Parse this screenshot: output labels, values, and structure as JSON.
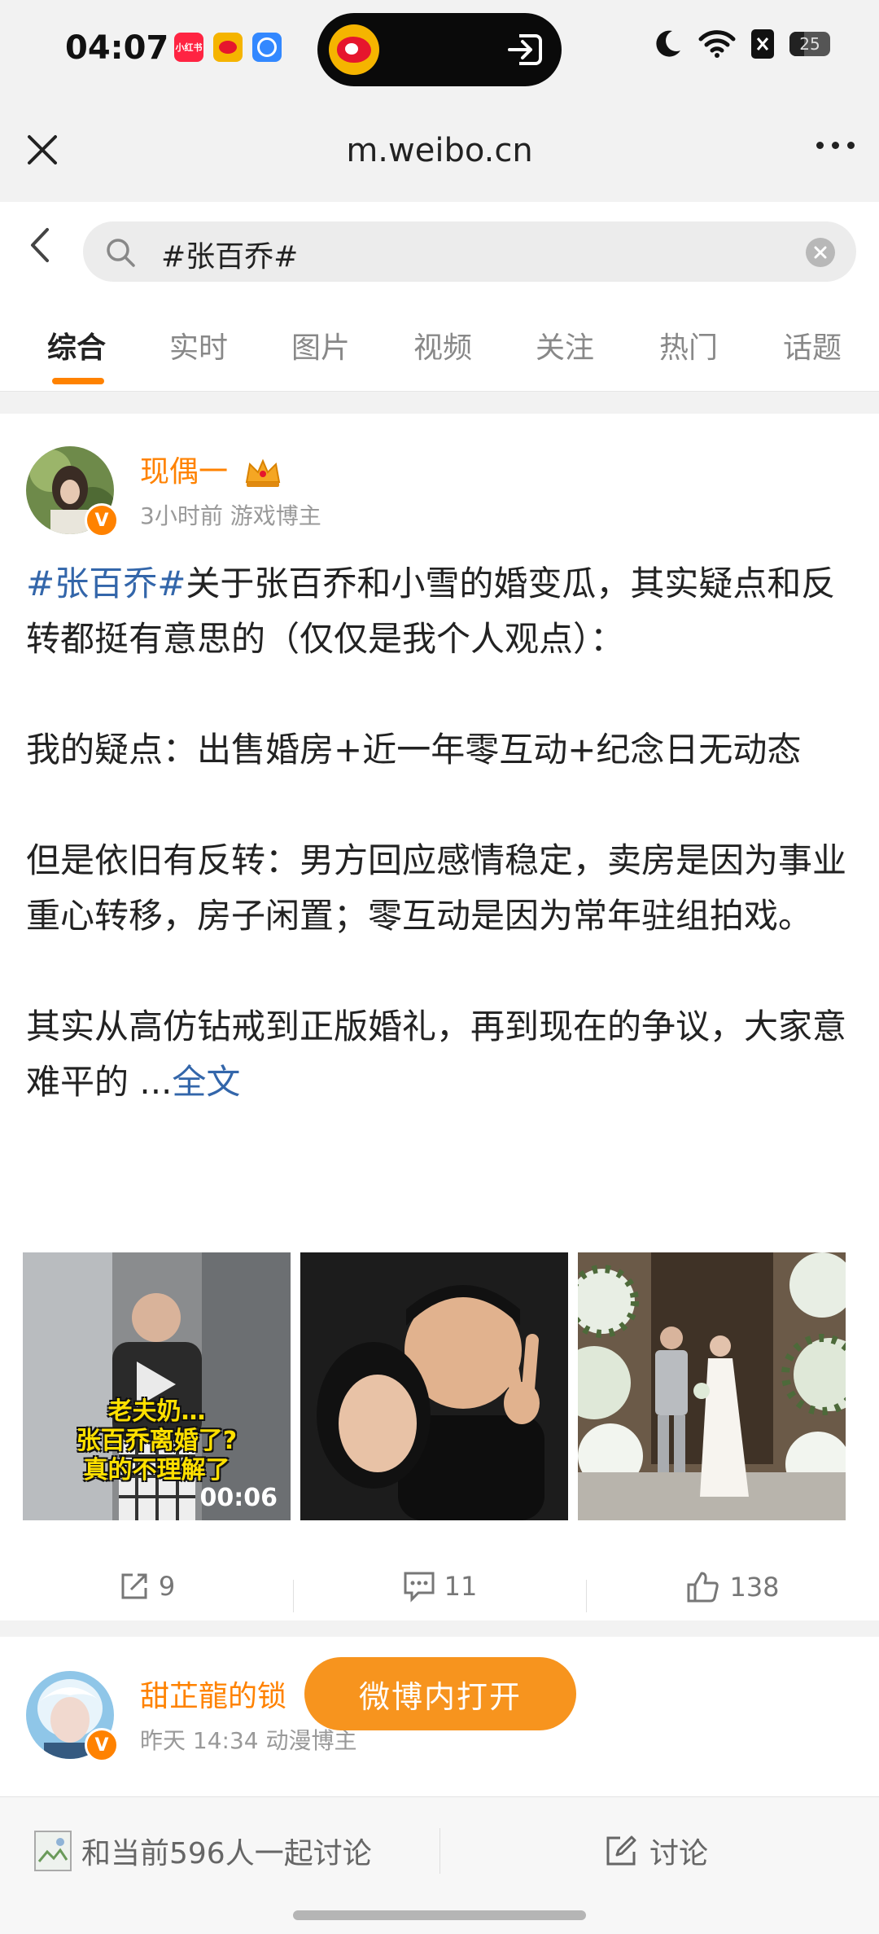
{
  "status_bar": {
    "time": "04:07",
    "app_badges": [
      {
        "label": "小红书",
        "color": "#ff2442"
      },
      {
        "label": "微博",
        "color": "#f5b400"
      },
      {
        "label": "百度",
        "color": "#3388ff"
      }
    ],
    "battery": "25"
  },
  "browser": {
    "url": "m.weibo.cn"
  },
  "search": {
    "query": "#张百乔#"
  },
  "tabs": [
    {
      "label": "综合",
      "active": true
    },
    {
      "label": "实时"
    },
    {
      "label": "图片"
    },
    {
      "label": "视频"
    },
    {
      "label": "关注"
    },
    {
      "label": "热门"
    },
    {
      "label": "话题"
    }
  ],
  "post1": {
    "author": "现偶一",
    "meta": "3小时前 游戏博主",
    "hashtag": "#张百乔#",
    "para1": "关于张百乔和小雪的婚变瓜，其实疑点和反转都挺有意思的（仅仅是我个人观点）：",
    "para2": "我的疑点：出售婚房+近一年零互动+纪念日无动态",
    "para3": "但是依旧有反转：男方回应感情稳定，卖房是因为事业重心转移，房子闲置；零互动是因为常年驻组拍戏。",
    "para4": "其实从高仿钻戒到正版婚礼，再到现在的争议，大家意难平的 ...",
    "more": "全文",
    "video_caption_1": "老夫奶…",
    "video_caption_2": "张百乔离婚了?",
    "video_caption_3": "真的不理解了",
    "video_duration": "00:06",
    "reposts": "9",
    "comments": "11",
    "likes": "138"
  },
  "post2": {
    "author": "甜芷龍的锁",
    "meta": "昨天 14:34 动漫博主"
  },
  "open_in_app": "微博内打开",
  "bottom_bar": {
    "discuss_count_text": "和当前596人一起讨论",
    "discuss_button": "讨论"
  },
  "colors": {
    "accent": "#ff8200",
    "link": "#3366aa",
    "open_button": "#f7941e"
  }
}
